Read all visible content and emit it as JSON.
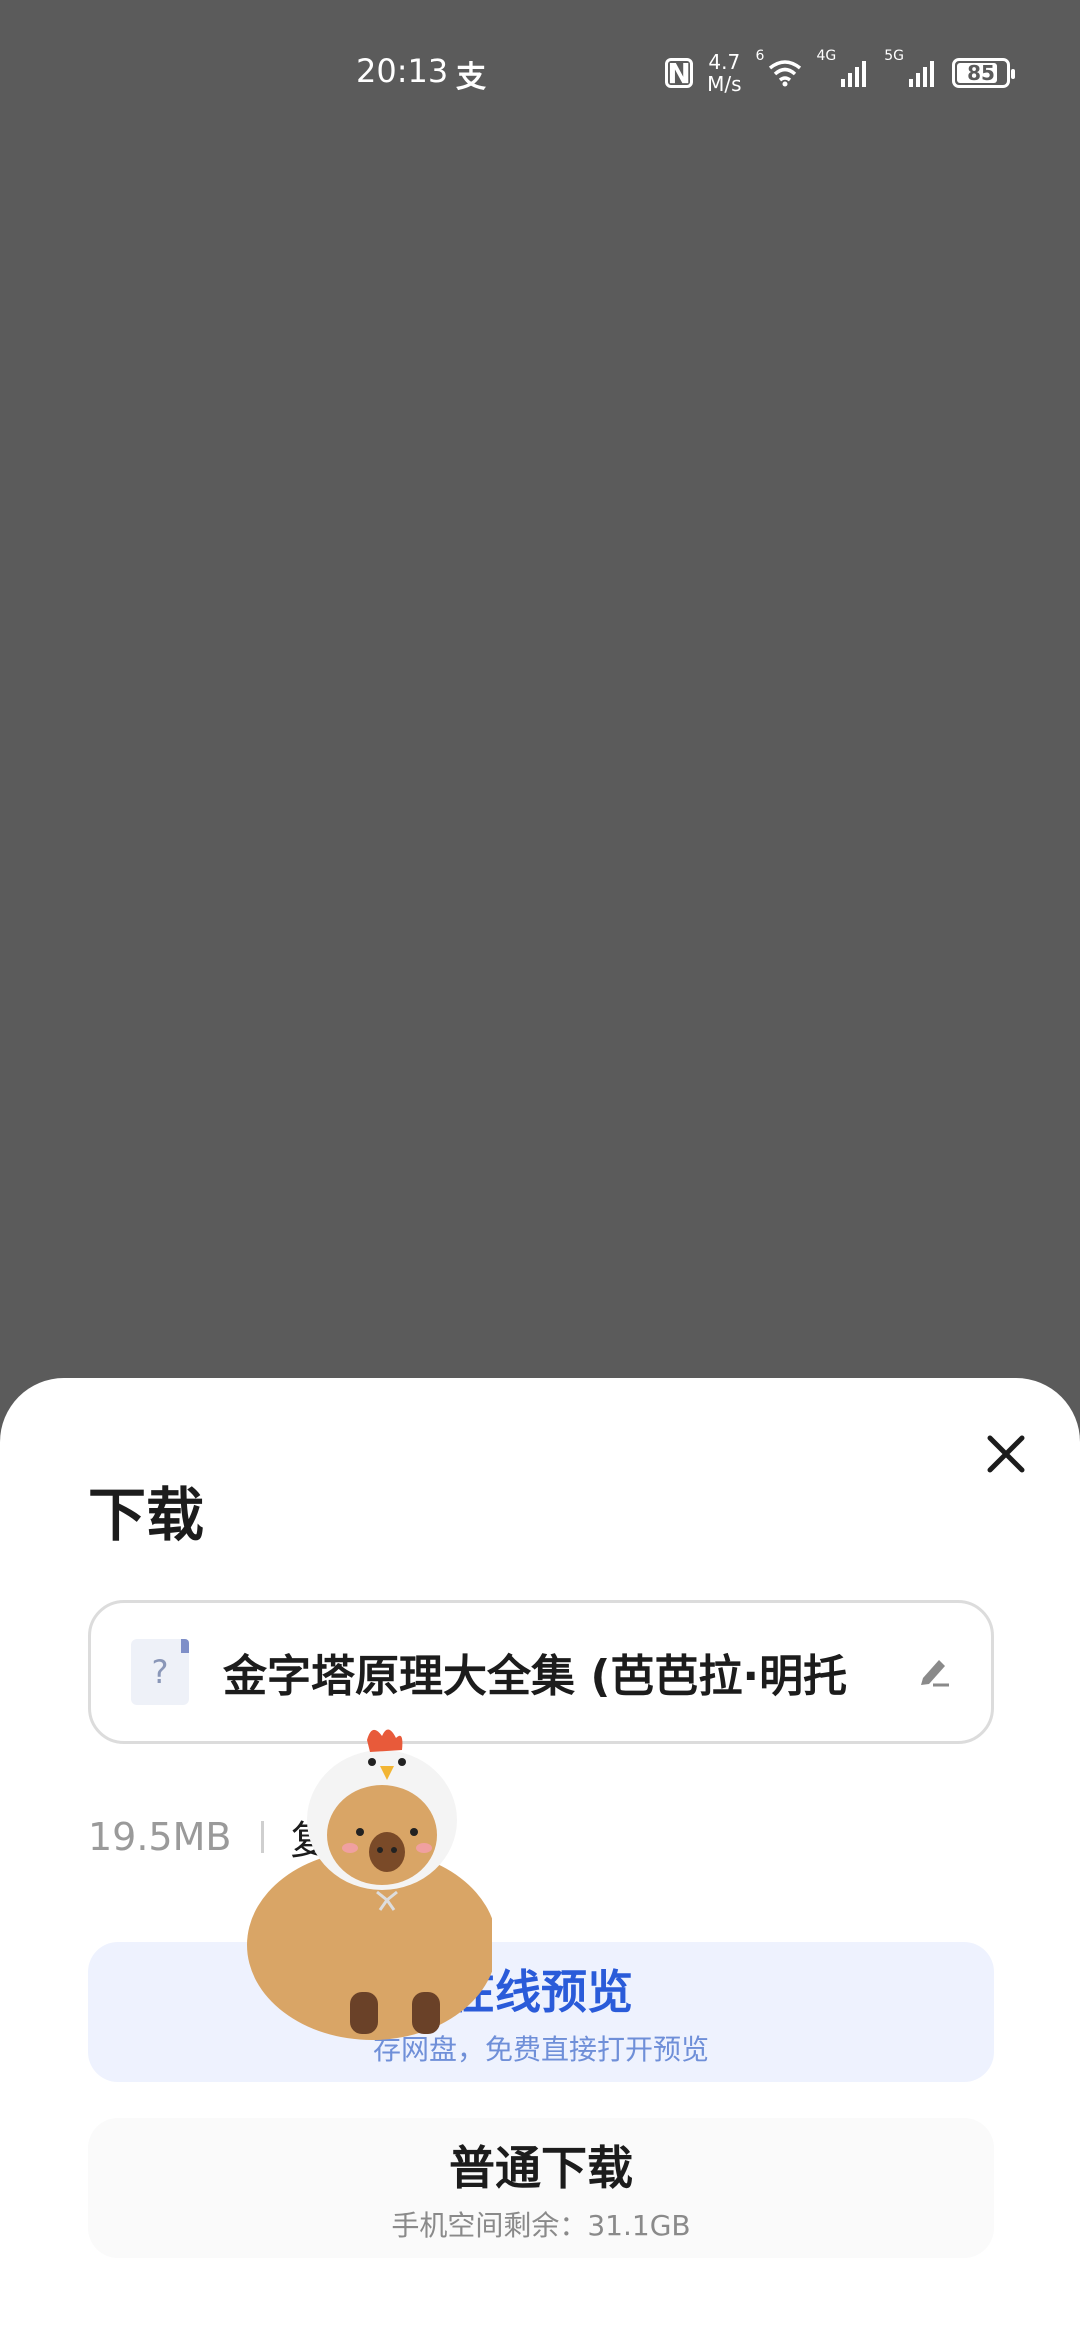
{
  "status_bar": {
    "time": "20:13",
    "pay_glyph": "支",
    "speed_value": "4.7",
    "speed_unit": "M/s",
    "net1": "4G",
    "net2": "5G",
    "wifi_tag": "6",
    "battery": "85",
    "battery_level": 0.85,
    "icons": [
      "nfc-icon",
      "wifi-icon",
      "signal-icon",
      "battery-icon"
    ]
  },
  "sheet": {
    "title": "下载",
    "close_icon": "close-icon",
    "filename": "金字塔原理大全集 (芭芭拉·明托",
    "file_icon_glyph": "?",
    "edit_icon": "edit-icon",
    "size": "19.5MB",
    "size_extra": "复",
    "preview_title": "在线预览",
    "preview_sub": "存网盘，免费直接打开预览",
    "download_title": "普通下载",
    "download_sub": "手机空间剩余：31.1GB"
  },
  "colors": {
    "overlay": "#5b5b5b",
    "accent": "#2a5bd9",
    "preview_bg": "#eef2fe"
  }
}
